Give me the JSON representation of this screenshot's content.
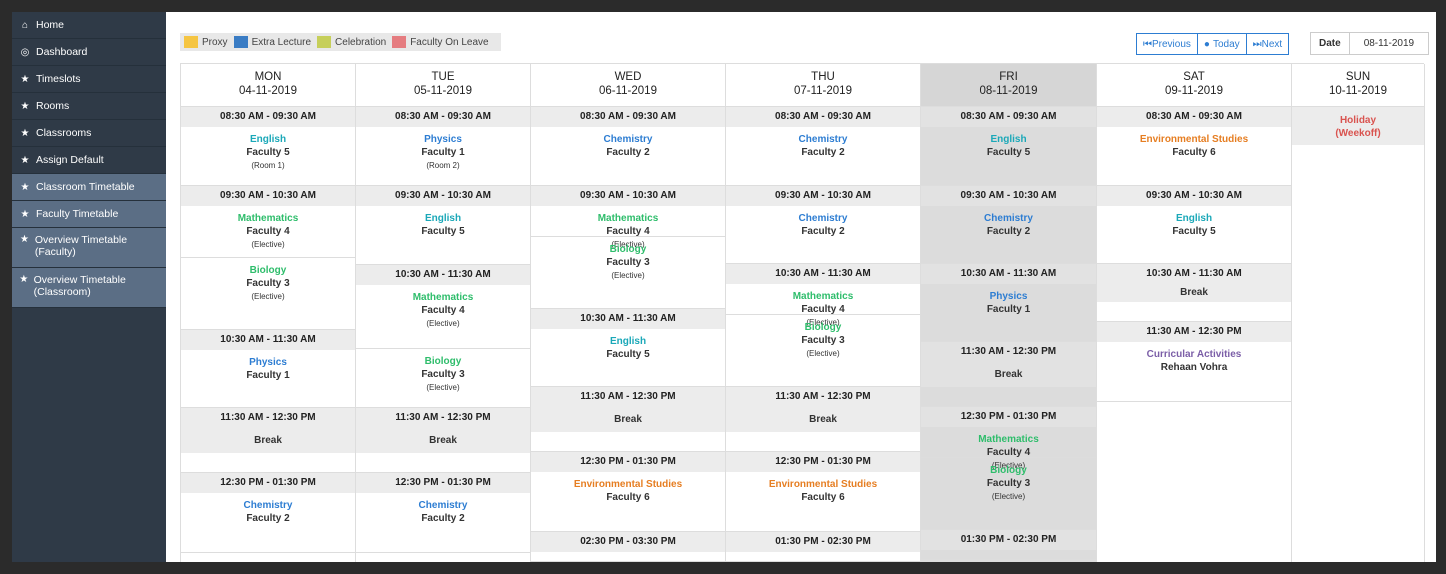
{
  "sidebar": {
    "items": [
      {
        "icon": "home-icon",
        "glyph": "⌂",
        "label": "Home"
      },
      {
        "icon": "dashboard-icon",
        "glyph": "◎",
        "label": "Dashboard"
      },
      {
        "icon": "star-icon",
        "glyph": "★",
        "label": "Timeslots"
      },
      {
        "icon": "star-icon",
        "glyph": "★",
        "label": "Rooms"
      },
      {
        "icon": "star-icon",
        "glyph": "★",
        "label": "Classrooms"
      },
      {
        "icon": "star-icon",
        "glyph": "★",
        "label": "Assign Default"
      },
      {
        "icon": "star-icon",
        "glyph": "★",
        "label": "Classroom Timetable"
      },
      {
        "icon": "star-icon",
        "glyph": "★",
        "label": "Faculty Timetable"
      },
      {
        "icon": "star-icon",
        "glyph": "★",
        "label": "Overview Timetable (Faculty)"
      },
      {
        "icon": "star-icon",
        "glyph": "★",
        "label": "Overview Timetable (Classroom)"
      }
    ]
  },
  "legend": [
    {
      "label": "Proxy",
      "color": "#f5c542"
    },
    {
      "label": "Extra Lecture",
      "color": "#3a7cc4"
    },
    {
      "label": "Celebration",
      "color": "#c6cf5a"
    },
    {
      "label": "Faculty On Leave",
      "color": "#e57c80"
    }
  ],
  "nav": {
    "previous": "Previous",
    "today": "Today",
    "next": "Next",
    "date_label": "Date",
    "date_value": "08-11-2019"
  },
  "colors": {
    "accent": "#2d7dd2",
    "sidebar": "#2f3a47",
    "sidebar_active": "#5b6e85",
    "holiday": "#d9534f"
  },
  "days": [
    {
      "name": "MON",
      "date": "04-11-2019",
      "slots": [
        {
          "time": "08:30 AM - 09:30 AM",
          "subject": "English",
          "color": "teal",
          "faculty": "Faculty 5",
          "note": "(Room 1)"
        },
        {
          "time": "09:30 AM - 10:30 AM",
          "subject": "Mathematics",
          "color": "green",
          "faculty": "Faculty 4",
          "note": "(Elective)"
        },
        {
          "subject": "Biology",
          "color": "green",
          "faculty": "Faculty 3",
          "note": "(Elective)"
        },
        {
          "time": "10:30 AM - 11:30 AM",
          "subject": "Physics",
          "color": "blue",
          "faculty": "Faculty 1"
        },
        {
          "time": "11:30 AM - 12:30 PM",
          "break": "Break"
        },
        {
          "time": "12:30 PM - 01:30 PM",
          "subject": "Chemistry",
          "color": "blue",
          "faculty": "Faculty 2"
        }
      ]
    },
    {
      "name": "TUE",
      "date": "05-11-2019",
      "slots": [
        {
          "time": "08:30 AM - 09:30 AM",
          "subject": "Physics",
          "color": "blue",
          "faculty": "Faculty 1",
          "note": "(Room 2)"
        },
        {
          "time": "09:30 AM - 10:30 AM",
          "subject": "English",
          "color": "teal",
          "faculty": "Faculty 5"
        },
        {
          "time": "10:30 AM - 11:30 AM",
          "subject": "Mathematics",
          "color": "green",
          "faculty": "Faculty 4",
          "note": "(Elective)"
        },
        {
          "subject": "Biology",
          "color": "green",
          "faculty": "Faculty 3",
          "note": "(Elective)"
        },
        {
          "time": "11:30 AM - 12:30 PM",
          "break": "Break"
        },
        {
          "time": "12:30 PM - 01:30 PM",
          "subject": "Chemistry",
          "color": "blue",
          "faculty": "Faculty 2"
        }
      ]
    },
    {
      "name": "WED",
      "date": "06-11-2019",
      "slots": [
        {
          "time": "08:30 AM - 09:30 AM",
          "subject": "Chemistry",
          "color": "blue",
          "faculty": "Faculty 2"
        },
        {
          "time": "09:30 AM - 10:30 AM",
          "subject": "Mathematics",
          "color": "green",
          "faculty": "Faculty 4",
          "note": "(Elective)"
        },
        {
          "subject": "Biology",
          "color": "green",
          "faculty": "Faculty 3",
          "note": "(Elective)"
        },
        {
          "time": "10:30 AM - 11:30 AM",
          "subject": "English",
          "color": "teal",
          "faculty": "Faculty 5"
        },
        {
          "time": "11:30 AM - 12:30 PM",
          "break": "Break"
        },
        {
          "time": "12:30 PM - 01:30 PM",
          "subject": "Environmental Studies",
          "color": "orange",
          "faculty": "Faculty 6"
        },
        {
          "time": "02:30 PM - 03:30 PM"
        }
      ]
    },
    {
      "name": "THU",
      "date": "07-11-2019",
      "slots": [
        {
          "time": "08:30 AM - 09:30 AM",
          "subject": "Chemistry",
          "color": "blue",
          "faculty": "Faculty 2"
        },
        {
          "time": "09:30 AM - 10:30 AM",
          "subject": "Chemistry",
          "color": "blue",
          "faculty": "Faculty 2"
        },
        {
          "time": "10:30 AM - 11:30 AM",
          "subject": "Mathematics",
          "color": "green",
          "faculty": "Faculty 4",
          "note": "(Elective)"
        },
        {
          "subject": "Biology",
          "color": "green",
          "faculty": "Faculty 3",
          "note": "(Elective)"
        },
        {
          "time": "11:30 AM - 12:30 PM",
          "break": "Break"
        },
        {
          "time": "12:30 PM - 01:30 PM",
          "subject": "Environmental Studies",
          "color": "orange",
          "faculty": "Faculty 6"
        },
        {
          "time": "01:30 PM - 02:30 PM"
        }
      ]
    },
    {
      "name": "FRI",
      "date": "08-11-2019",
      "slots": [
        {
          "time": "08:30 AM - 09:30 AM",
          "subject": "English",
          "color": "teal",
          "faculty": "Faculty 5"
        },
        {
          "time": "09:30 AM - 10:30 AM",
          "subject": "Chemistry",
          "color": "blue",
          "faculty": "Faculty 2"
        },
        {
          "time": "10:30 AM - 11:30 AM",
          "subject": "Physics",
          "color": "blue",
          "faculty": "Faculty 1"
        },
        {
          "time": "11:30 AM - 12:30 PM",
          "break": "Break"
        },
        {
          "time": "12:30 PM - 01:30 PM",
          "subject": "Mathematics",
          "color": "green",
          "faculty": "Faculty 4",
          "note": "(Elective)"
        },
        {
          "subject": "Biology",
          "color": "green",
          "faculty": "Faculty 3",
          "note": "(Elective)"
        },
        {
          "time": "01:30 PM - 02:30 PM"
        }
      ]
    },
    {
      "name": "SAT",
      "date": "09-11-2019",
      "slots": [
        {
          "time": "08:30 AM - 09:30 AM",
          "subject": "Environmental Studies",
          "color": "orange",
          "faculty": "Faculty 6"
        },
        {
          "time": "09:30 AM - 10:30 AM",
          "subject": "English",
          "color": "teal",
          "faculty": "Faculty 5"
        },
        {
          "time": "10:30 AM - 11:30 AM",
          "break": "Break"
        },
        {
          "time": "11:30 AM - 12:30 PM",
          "subject": "Curricular Activities",
          "color": "purple",
          "faculty": "Rehaan Vohra"
        }
      ]
    },
    {
      "name": "SUN",
      "date": "10-11-2019",
      "holiday": "Holiday (Weekoff)"
    }
  ]
}
